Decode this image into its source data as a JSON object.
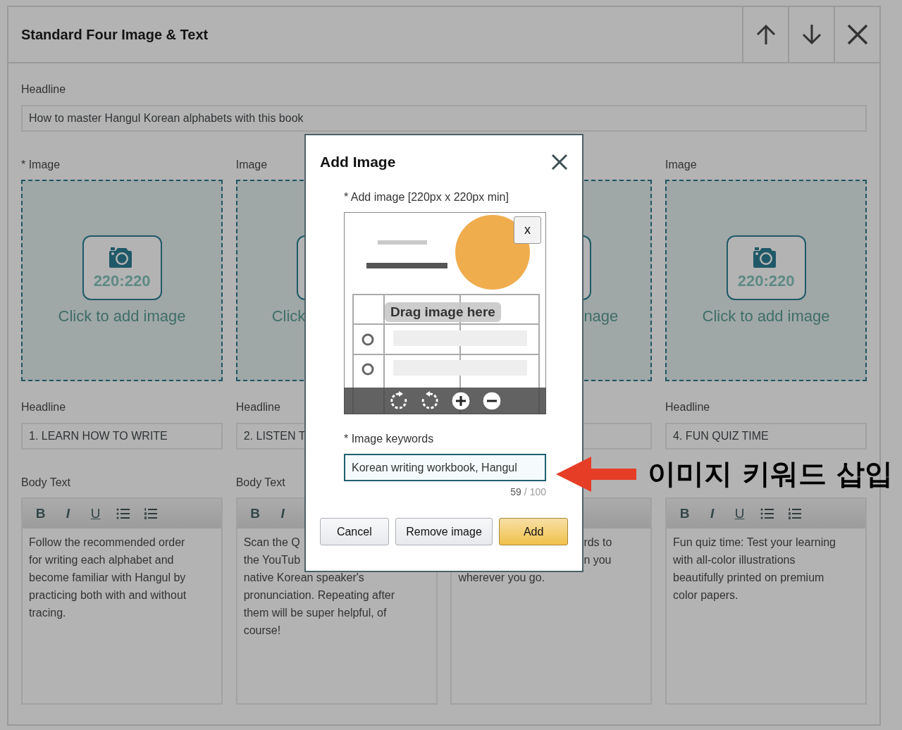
{
  "module": {
    "title": "Standard Four Image & Text",
    "actions": [
      {
        "kind": "up"
      },
      {
        "kind": "down"
      },
      {
        "kind": "close"
      }
    ]
  },
  "headline": {
    "label": "Headline",
    "value": "How to master Hangul Korean alphabets with this book"
  },
  "columns": [
    {
      "image_label": "* Image",
      "zone": {
        "ratio": "220:220",
        "caption": "Click to add image"
      },
      "headline_label": "Headline",
      "headline_value": "1. LEARN HOW TO WRITE",
      "body_label": "Body Text",
      "tools": [
        {
          "kind": "bold",
          "label": "B"
        },
        {
          "kind": "italic",
          "label": "I"
        },
        {
          "kind": "underline",
          "label": "U"
        },
        {
          "kind": "bullets"
        },
        {
          "kind": "numbers"
        }
      ],
      "body_lines": [
        {
          "text": "Follow the recommended order"
        },
        {
          "text": "for writing each alphabet and"
        },
        {
          "text": "become familiar with Hangul by"
        },
        {
          "text": "practicing both with and without"
        },
        {
          "text": "tracing."
        }
      ]
    },
    {
      "image_label": "Image",
      "zone": {
        "caption": "Click",
        "cut_end": true
      },
      "headline_label": "Headline",
      "headline_value": "2. LISTEN T",
      "body_label": "Body Text",
      "tools": [
        {
          "kind": "bold",
          "label": "B"
        },
        {
          "kind": "italic",
          "label": "I"
        }
      ],
      "body_lines": [
        {
          "text": "Scan the Q"
        },
        {
          "text": "the YouTub"
        },
        {
          "text": "native Korean speaker's"
        },
        {
          "text": "pronunciation. Repeating after"
        },
        {
          "text": "them will be super helpful, of"
        },
        {
          "text": "course!"
        }
      ]
    },
    {
      "zone": {
        "caption": "nage",
        "cut_start": true
      },
      "body_lines": [
        {
          "text": "rds to",
          "cut_start": true
        },
        {
          "text": "n you",
          "cut_start": true
        },
        {
          "text": "wherever you go."
        }
      ]
    },
    {
      "image_label": "Image",
      "zone": {
        "ratio": "220:220",
        "caption": "Click to add image"
      },
      "headline_label": "Headline",
      "headline_value": "4. FUN QUIZ TIME",
      "tools": [
        {
          "kind": "bold",
          "label": "B"
        },
        {
          "kind": "italic",
          "label": "I"
        },
        {
          "kind": "underline",
          "label": "U"
        },
        {
          "kind": "bullets"
        },
        {
          "kind": "numbers"
        }
      ],
      "body_lines": [
        {
          "text": "Fun quiz time: Test your learning"
        },
        {
          "text": "with all-color illustrations"
        },
        {
          "text": "beautifully printed on premium"
        },
        {
          "text": "color papers."
        }
      ]
    }
  ],
  "dialog": {
    "title": "Add Image",
    "image_label": "* Add image [220px x 220px min]",
    "preview": {
      "kind": "picture",
      "remove": "x",
      "hint": "Drag image here",
      "tools": [
        {
          "kind": "rotate-right"
        },
        {
          "kind": "rotate-left"
        },
        {
          "kind": "zoom-in"
        },
        {
          "kind": "zoom-out"
        }
      ]
    },
    "keywords_label": "* Image keywords",
    "keywords_value": "Korean writing workbook, Hangul",
    "count": "59",
    "limit": "/ 100",
    "buttons": [
      {
        "label": "Cancel",
        "primary": false
      },
      {
        "label": "Remove image",
        "primary": false
      },
      {
        "label": "Add",
        "primary": true
      }
    ]
  },
  "annotation": {
    "text": "이미지 키워드 삽입"
  }
}
